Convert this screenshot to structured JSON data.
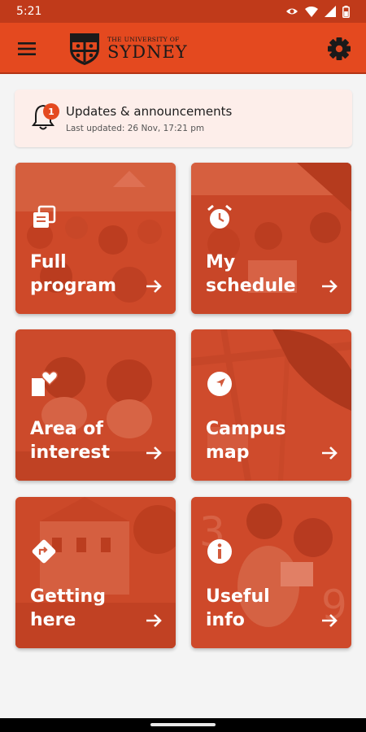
{
  "status_bar": {
    "time": "5:21"
  },
  "app_bar": {
    "logo_line1": "THE UNIVERSITY OF",
    "logo_line2": "SYDNEY"
  },
  "announcement": {
    "title": "Updates & announcements",
    "subtitle": "Last updated: 26 Nov, 17:21 pm",
    "badge_count": "1"
  },
  "tiles": [
    {
      "line1": "Full",
      "line2": "program",
      "icon": "program-icon"
    },
    {
      "line1": "My",
      "line2": "schedule",
      "icon": "alarm-clock-icon"
    },
    {
      "line1": "Area of",
      "line2": "interest",
      "icon": "tag-heart-icon"
    },
    {
      "line1": "Campus",
      "line2": "map",
      "icon": "navigation-icon"
    },
    {
      "line1": "Getting",
      "line2": "here",
      "icon": "directions-icon"
    },
    {
      "line1": "Useful",
      "line2": "info",
      "icon": "info-icon"
    }
  ],
  "colors": {
    "brand": "#e4491f",
    "status_bar": "#c03a1a",
    "announcement_bg": "#fdeeea"
  }
}
